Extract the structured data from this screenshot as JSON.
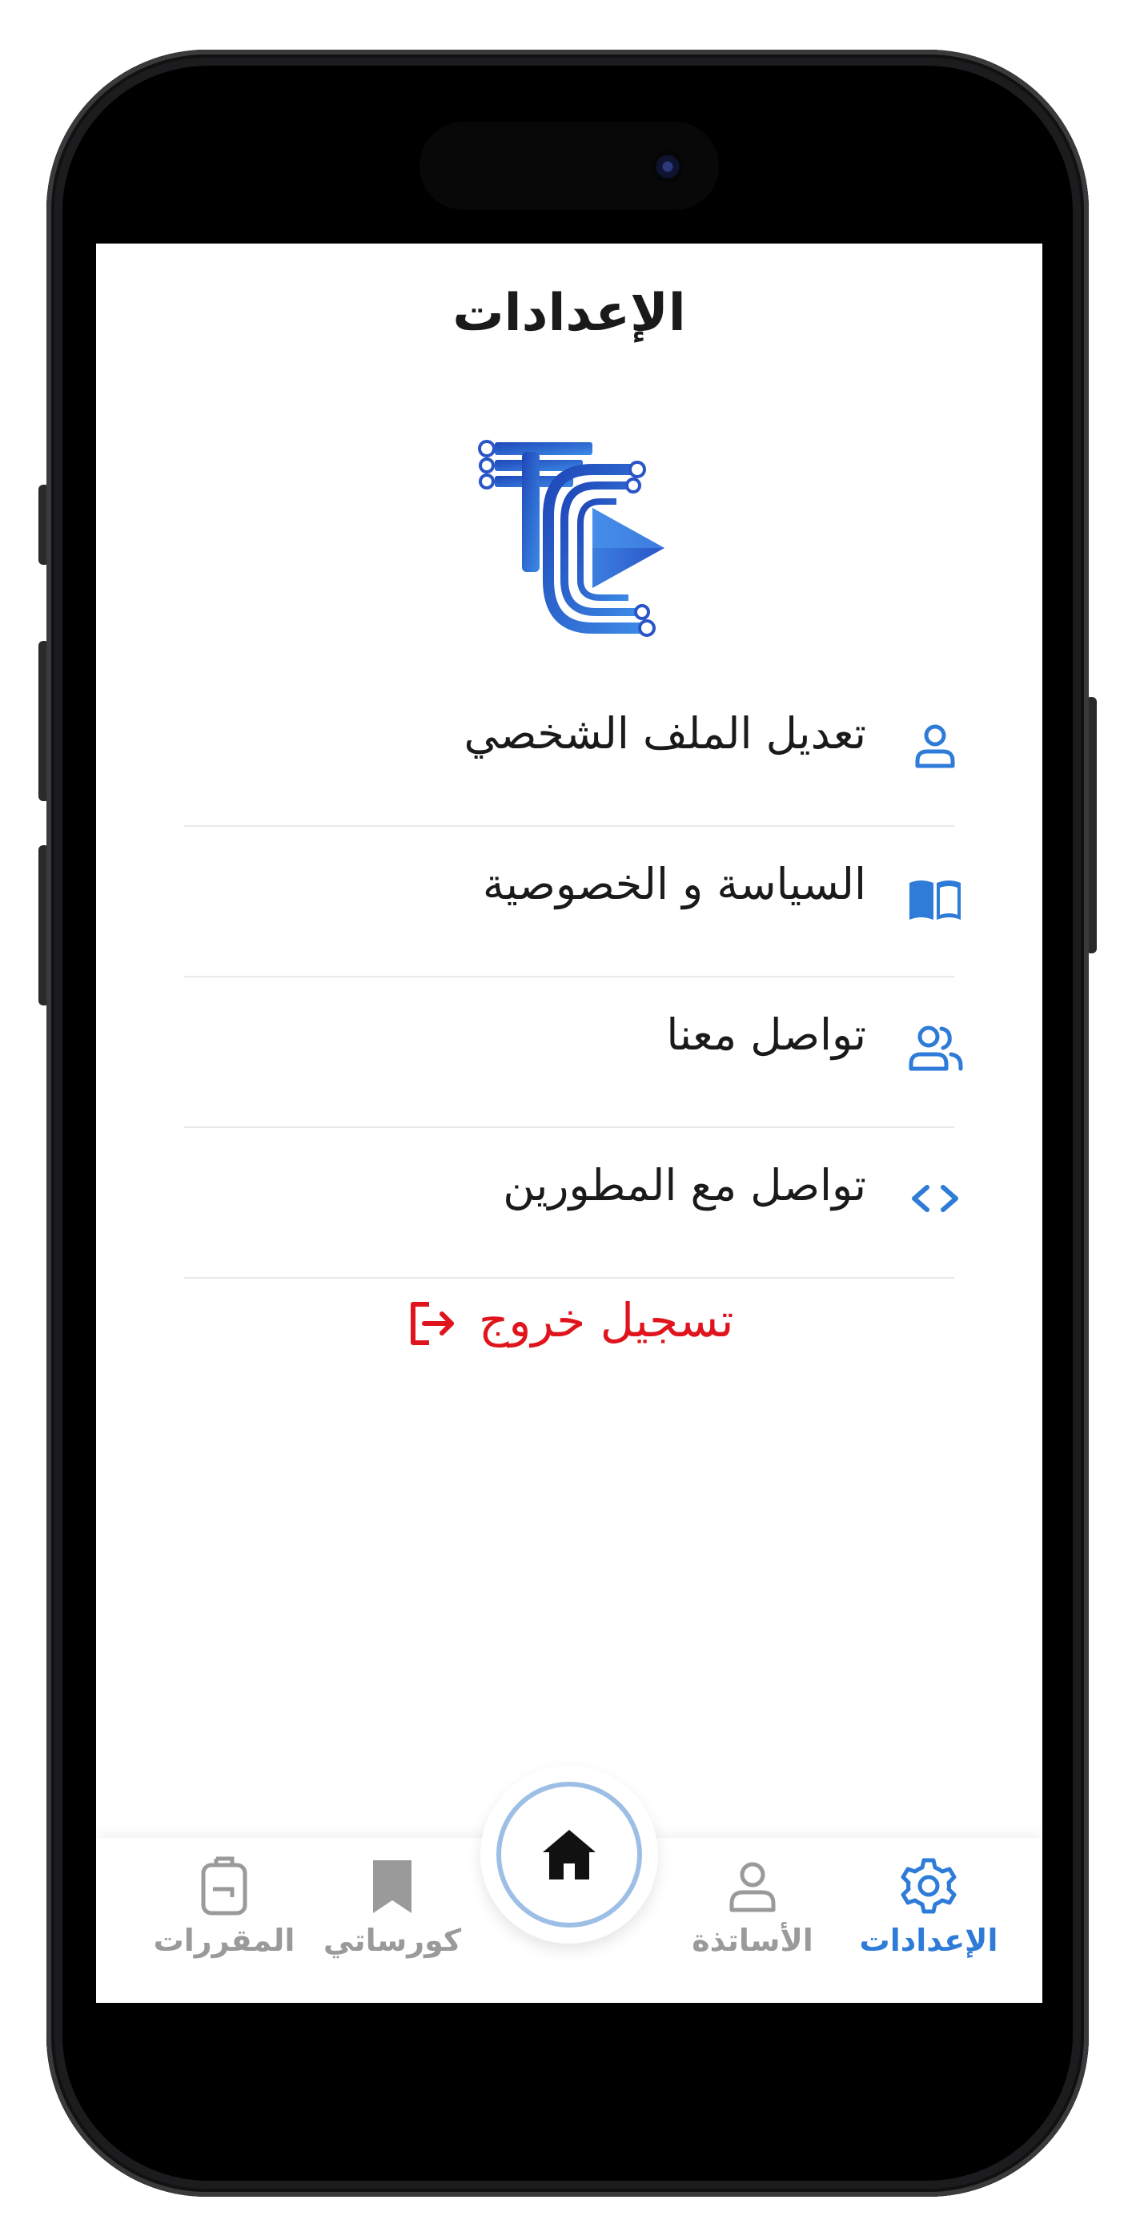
{
  "header": {
    "title": "الإعدادات"
  },
  "menu": {
    "items": [
      {
        "label": "تعديل الملف الشخصي",
        "icon": "user-icon"
      },
      {
        "label": "السياسة و الخصوصية",
        "icon": "book-icon"
      },
      {
        "label": "تواصل معنا",
        "icon": "users-icon"
      },
      {
        "label": "تواصل مع المطورين",
        "icon": "code-icon"
      }
    ]
  },
  "logout": {
    "label": "تسجيل خروج",
    "icon": "logout-icon"
  },
  "tabbar": {
    "items": [
      {
        "label": "الإعدادات",
        "icon": "gear-icon",
        "active": true
      },
      {
        "label": "الأساتذة",
        "icon": "user-icon",
        "active": false
      },
      {
        "label": "كورساتي",
        "icon": "bookmark-icon",
        "active": false
      },
      {
        "label": "المقررات",
        "icon": "backpack-icon",
        "active": false
      }
    ],
    "home": {
      "icon": "home-icon"
    }
  },
  "colors": {
    "accent": "#2e7bd8",
    "logout": "#e0141c",
    "inactive": "#9a9a9a",
    "text": "#1a1a1a"
  }
}
